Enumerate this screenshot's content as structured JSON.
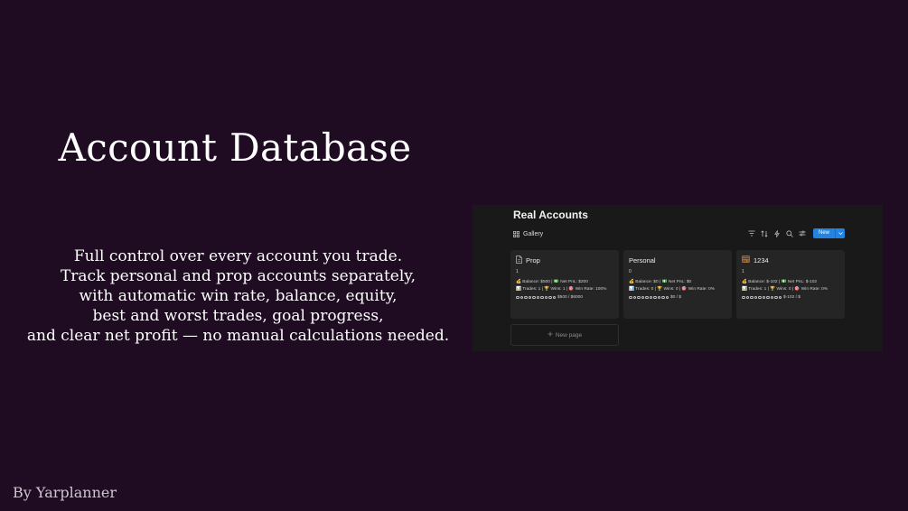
{
  "hero": {
    "title": "Account Database",
    "description_lines": [
      "Full control over every account you trade.",
      "Track personal and prop accounts separately,",
      "with automatic win rate, balance, equity,",
      "best and worst trades, goal progress,",
      "and clear net profit — no manual calculations needed."
    ]
  },
  "byline": "By Yarplanner",
  "screenshot": {
    "database_title": "Real Accounts",
    "view_tab": {
      "label": "Gallery",
      "icon": "gallery-grid-icon"
    },
    "toolbar": {
      "icons": [
        "filter-icon",
        "sort-icon",
        "lightning-icon",
        "search-icon",
        "settings-sliders-icon"
      ],
      "new_button_label": "New"
    },
    "cards": [
      {
        "icon": "page-icon",
        "title": "Prop",
        "id": "1",
        "balance_line": "💰 Balance: $500 | 💵 Net PnL: $200",
        "trades_line": "📊 Trades: 1 | 🏆 Wins: 1 | 🎯 Win Rate: 100%",
        "progress": "$500 / $6000"
      },
      {
        "icon": "",
        "title": "Personal",
        "id": "0",
        "balance_line": "💰 Balance: $0 | 💵 Net PnL: $0",
        "trades_line": "📊 Trades: 0 | 🏆 Wins: 0 | 🎯 Win Rate: 0%",
        "progress": "$0 / $"
      },
      {
        "icon": "abacus-icon",
        "title": "1234",
        "id": "1",
        "balance_line": "💰 Balance: $-102 | 💵 Net PnL: $-102",
        "trades_line": "📊 Trades: 1 | 🏆 Wins: 0 | 🎯 Win Rate: 0%",
        "progress": "$-102 / $"
      }
    ],
    "new_page_label": "New page",
    "colors": {
      "page_background": "#1f0b22",
      "panel_background": "#191919",
      "card_background": "#252525",
      "accent_button": "#2383e2"
    }
  }
}
